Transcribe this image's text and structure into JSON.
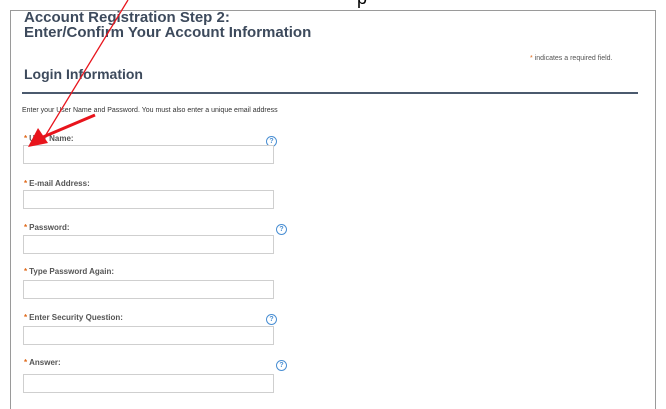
{
  "header": {
    "title_line1": "Account Registration Step 2:",
    "title_line2": "Enter/Confirm Your Account Information",
    "partial_top_text": "p"
  },
  "required_note": {
    "star": "*",
    "text": " indicates a required field."
  },
  "section": {
    "title": "Login Information",
    "intro": "Enter your User Name and Password.  You must also enter a unique email address"
  },
  "fields": [
    {
      "label": "User Name:",
      "has_help": true,
      "value": ""
    },
    {
      "label": "E-mail Address:",
      "has_help": false,
      "value": ""
    },
    {
      "label": "Password:",
      "has_help": true,
      "value": ""
    },
    {
      "label": "Type Password Again:",
      "has_help": false,
      "value": ""
    },
    {
      "label": "Enter Security Question:",
      "has_help": true,
      "value": ""
    },
    {
      "label": "Answer:",
      "has_help": true,
      "value": ""
    }
  ],
  "help_glyph": "?",
  "colors": {
    "title": "#3d4a5c",
    "required_star": "#e06a1a",
    "help_icon": "#4a8fd3",
    "annotation_arrow": "#e8141c"
  },
  "icons": {
    "help": "question-circle-icon",
    "annotation": "red-arrow-icon"
  }
}
